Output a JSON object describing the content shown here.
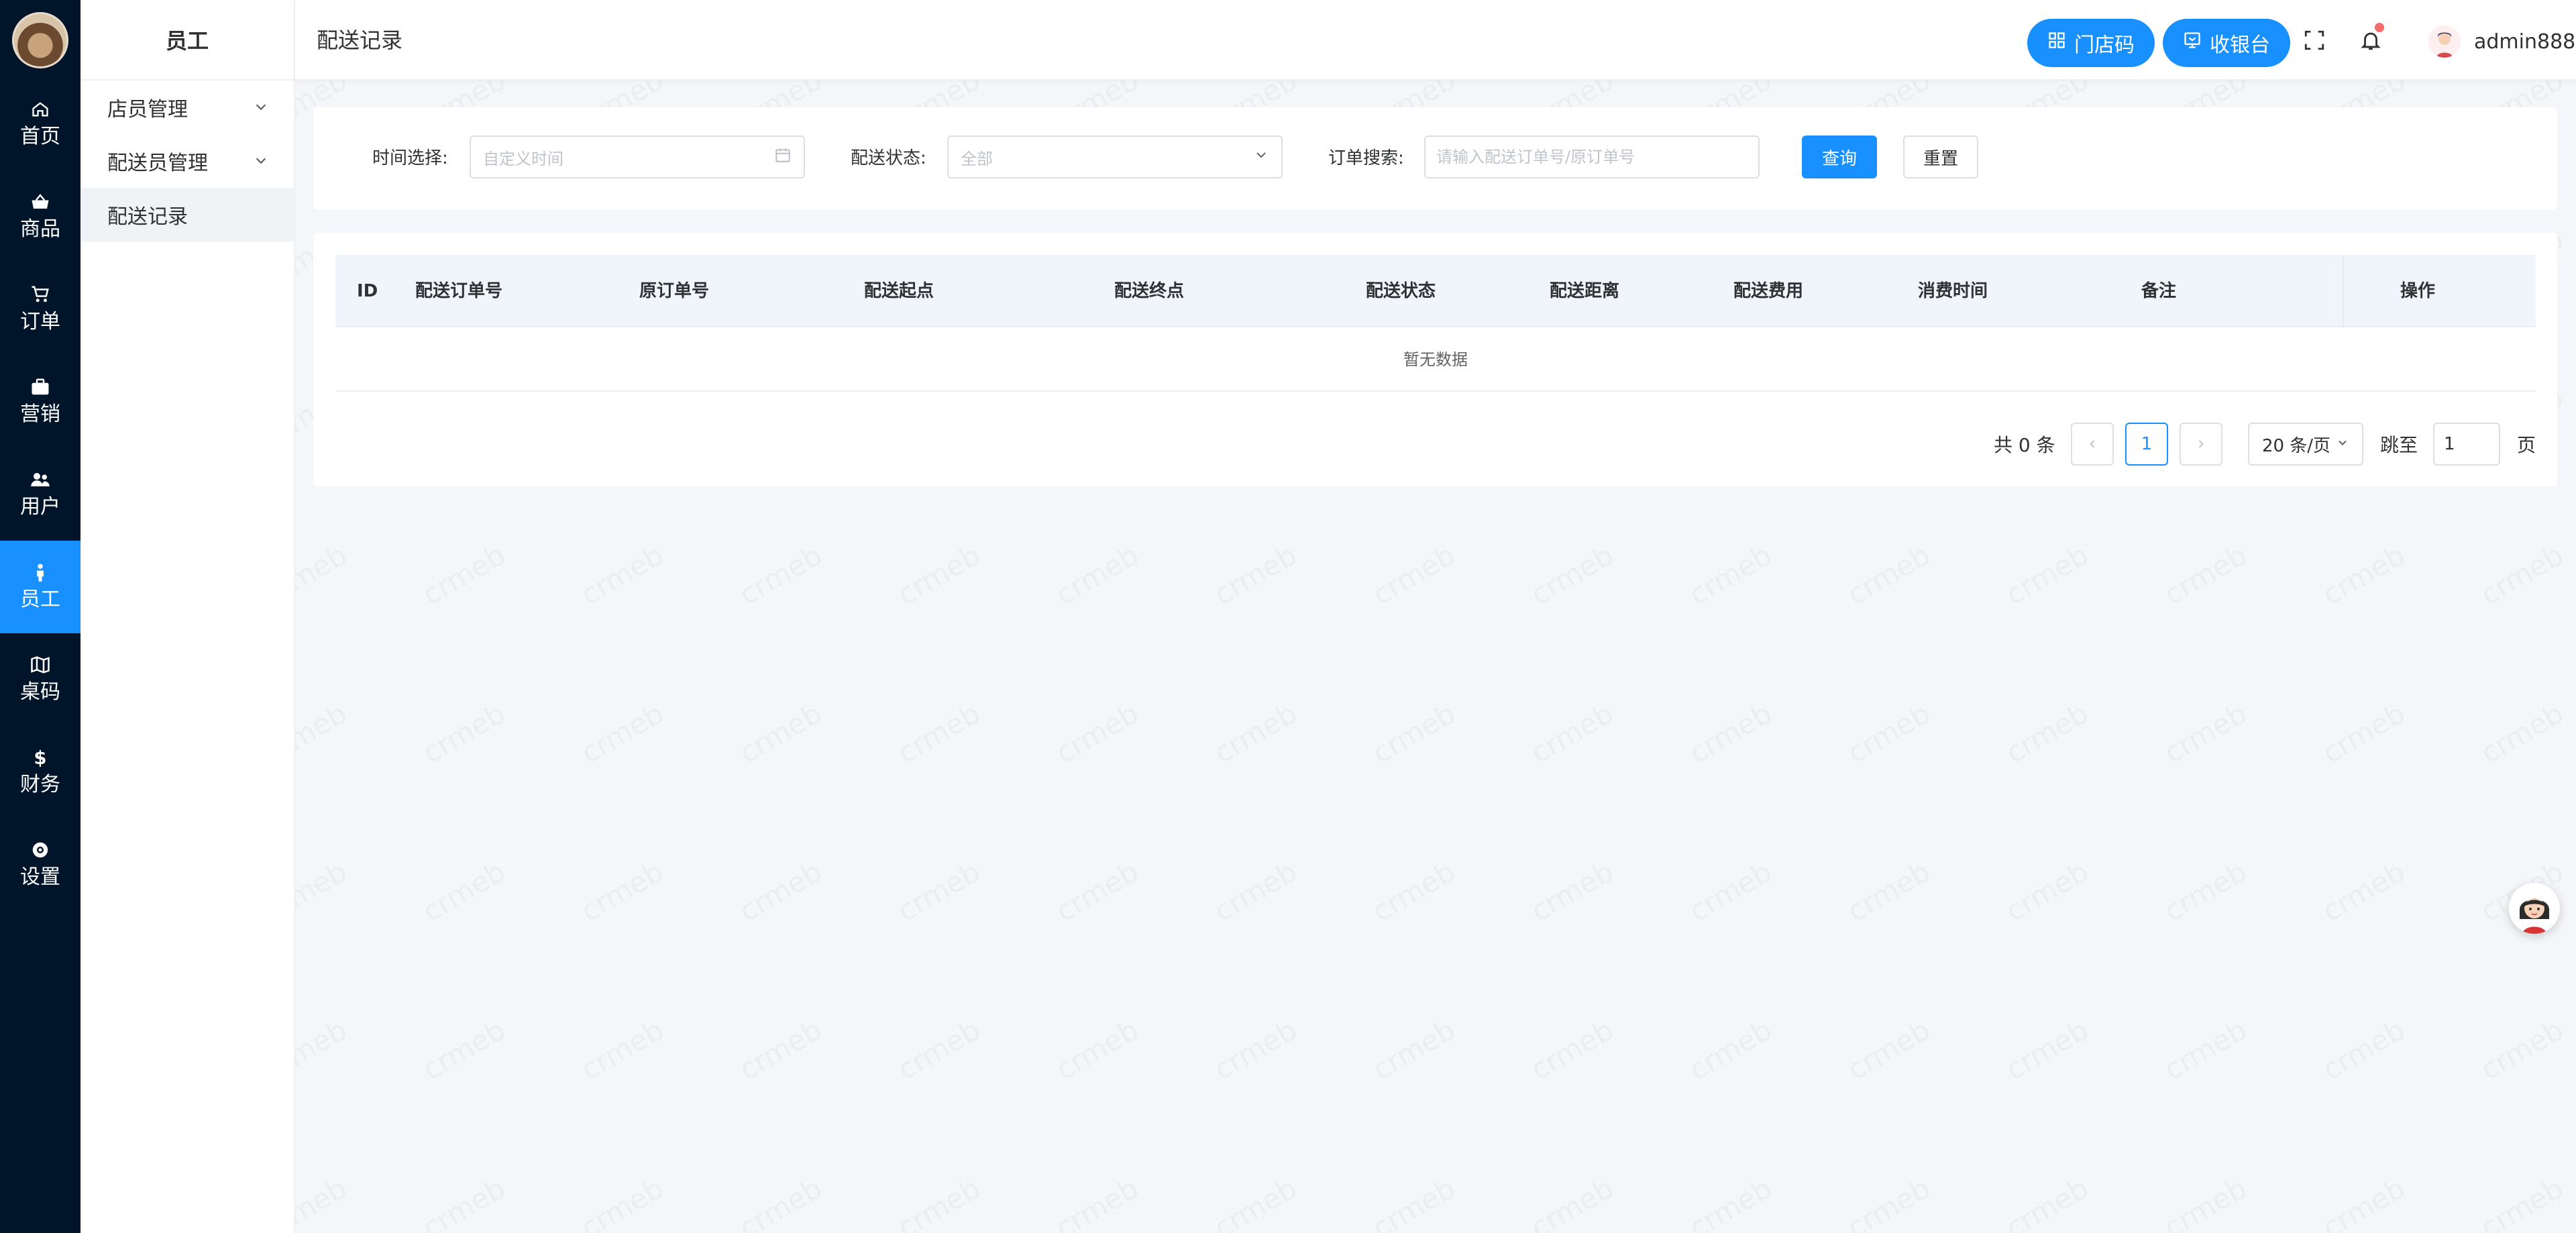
{
  "rail": {
    "items": [
      {
        "label": "首页",
        "icon": "home-icon"
      },
      {
        "label": "商品",
        "icon": "basket-icon"
      },
      {
        "label": "订单",
        "icon": "cart-icon"
      },
      {
        "label": "营销",
        "icon": "briefcase-icon"
      },
      {
        "label": "用户",
        "icon": "users-icon"
      },
      {
        "label": "员工",
        "icon": "person-icon"
      },
      {
        "label": "桌码",
        "icon": "map-icon"
      },
      {
        "label": "财务",
        "icon": "dollar-icon"
      },
      {
        "label": "设置",
        "icon": "gear-icon"
      }
    ],
    "active_index": 5
  },
  "submenu": {
    "title": "员工",
    "items": [
      {
        "label": "店员管理",
        "expandable": true
      },
      {
        "label": "配送员管理",
        "expandable": true
      },
      {
        "label": "配送记录",
        "expandable": false
      }
    ],
    "active_index": 2
  },
  "header": {
    "breadcrumb": "配送记录",
    "store_code_label": "门店码",
    "cashier_label": "收银台",
    "username": "admin888"
  },
  "filters": {
    "time_label": "时间选择:",
    "time_placeholder": "自定义时间",
    "status_label": "配送状态:",
    "status_value": "全部",
    "search_label": "订单搜索:",
    "search_placeholder": "请输入配送订单号/原订单号",
    "query_label": "查询",
    "reset_label": "重置"
  },
  "table": {
    "columns": [
      "ID",
      "配送订单号",
      "原订单号",
      "配送起点",
      "配送终点",
      "配送状态",
      "配送距离",
      "配送费用",
      "消费时间",
      "备注",
      "操作"
    ],
    "rows": [],
    "empty_text": "暂无数据"
  },
  "pagination": {
    "total_text": "共 0 条",
    "current_page": "1",
    "page_size_label": "20 条/页",
    "jump_label": "跳至",
    "jump_value": "1",
    "page_suffix": "页"
  },
  "colors": {
    "primary": "#1890ff",
    "rail_bg": "#001529",
    "badge": "#f56c6c"
  }
}
